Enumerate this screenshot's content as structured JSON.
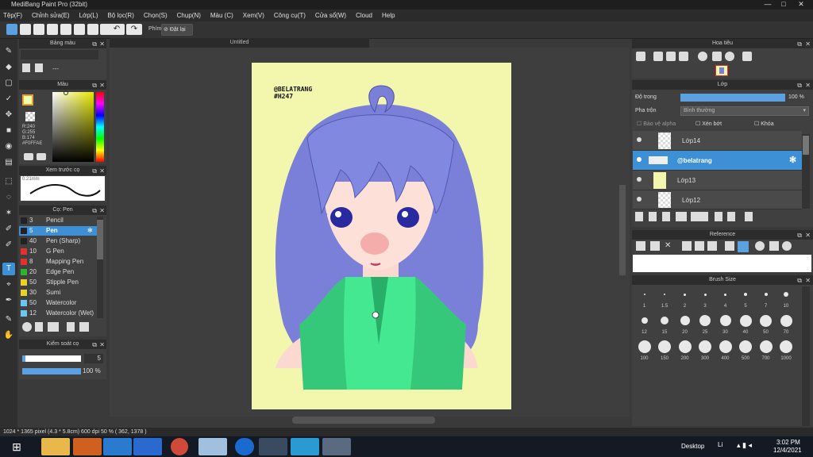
{
  "window": {
    "title": "MediBang Paint Pro (32bit)",
    "min": "—",
    "max": "□",
    "close": "✕"
  },
  "menu": [
    "Tệp(F)",
    "Chỉnh sửa(E)",
    "Lớp(L)",
    "Bộ lọc(R)",
    "Chọn(S)",
    "Chụp(N)",
    "Màu (C)",
    "Xem(V)",
    "Công cụ(T)",
    "Cửa sổ(W)",
    "Cloud",
    "Help"
  ],
  "toolbar": {
    "phim_label": "Phím",
    "reset_label": "Đặt lại"
  },
  "palette_panel": {
    "title": "Bảng màu",
    "dash": "---"
  },
  "color_panel": {
    "title": "Màu",
    "r": "R:240",
    "g": "G:255",
    "b": "B:174",
    "hex": "#F0FFAE",
    "fg_color": "#f0ffae"
  },
  "brush_preview": {
    "title": "Xem trước cọ",
    "size": "0.21mm"
  },
  "brush_panel": {
    "title": "Cọ: Pen",
    "items": [
      {
        "num": "3",
        "name": "Pencil",
        "color": "#222222"
      },
      {
        "num": "5",
        "name": "Pen",
        "color": "#222222"
      },
      {
        "num": "40",
        "name": "Pen (Sharp)",
        "color": "#222222"
      },
      {
        "num": "10",
        "name": "G Pen",
        "color": "#e53030"
      },
      {
        "num": "8",
        "name": "Mapping Pen",
        "color": "#e53030"
      },
      {
        "num": "20",
        "name": "Edge Pen",
        "color": "#2ab52a"
      },
      {
        "num": "50",
        "name": "Stipple Pen",
        "color": "#e8d22a"
      },
      {
        "num": "30",
        "name": "Sumi",
        "color": "#e8d22a"
      },
      {
        "num": "50",
        "name": "Watercolor",
        "color": "#6ac8f0"
      },
      {
        "num": "12",
        "name": "Watercolor (Wet)",
        "color": "#6ac8f0"
      }
    ]
  },
  "brush_control": {
    "title": "Kiểm soát cọ",
    "size": "5",
    "opacity": "100 %",
    "size_fill": 0.06,
    "opacity_fill": 1.0
  },
  "canvas": {
    "tab_title": "Untitled",
    "signature_line1": "@BELATRANG",
    "signature_line2": "#H247"
  },
  "navigator": {
    "title": "Hoa tiêu"
  },
  "layer_panel": {
    "title": "Lớp",
    "opacity_label": "Độ trong",
    "opacity_value": "100 %",
    "blend_label": "Pha trộn",
    "blend_value": "Bình thường",
    "protect_alpha": "Bảo vệ alpha",
    "clipping": "Xén bớt",
    "lock": "Khóa",
    "layers": [
      {
        "name": "Lớp14"
      },
      {
        "name": "@belatrang"
      },
      {
        "name": "Lớp13"
      },
      {
        "name": "Lớp12"
      }
    ]
  },
  "reference_panel": {
    "title": "Reference"
  },
  "brush_size_panel": {
    "title": "Brush Size",
    "sizes": [
      "1",
      "1.5",
      "2",
      "3",
      "4",
      "5",
      "7",
      "10",
      "12",
      "15",
      "20",
      "25",
      "30",
      "40",
      "50",
      "70",
      "100",
      "150",
      "200",
      "300",
      "400",
      "500",
      "700",
      "1000"
    ]
  },
  "status": {
    "text": "1024 * 1365 pixel  (4.3 * 5.8cm)  600 dpi  50 %  ( 362, 1378 )"
  },
  "taskbar": {
    "desktop": "Desktop",
    "lang": "Li",
    "time": "3:02 PM",
    "date": "12/4/2021"
  }
}
